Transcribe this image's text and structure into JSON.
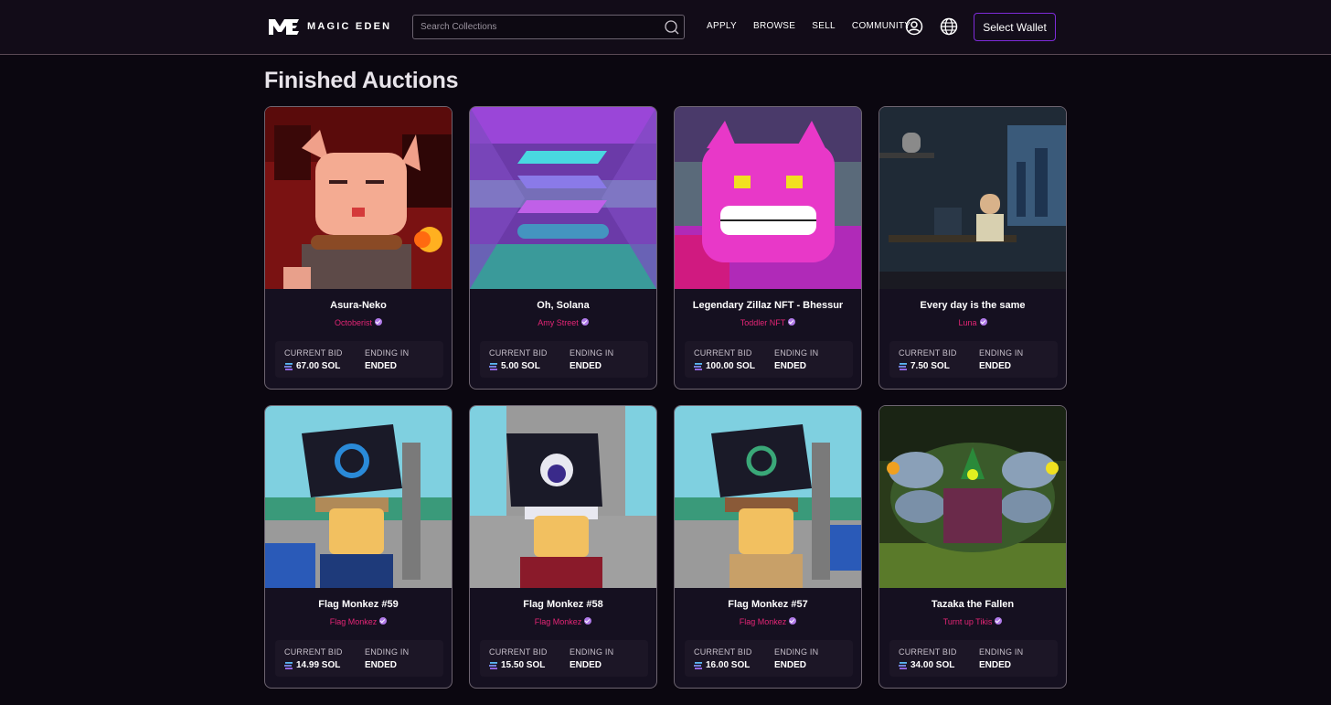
{
  "header": {
    "logo_text": "MAGIC EDEN",
    "search": {
      "placeholder": "Search Collections",
      "value": ""
    },
    "nav": [
      "APPLY",
      "BROWSE",
      "SELL",
      "COMMUNITY"
    ],
    "wallet_button": "Select Wallet"
  },
  "page_title": "Finished Auctions",
  "labels": {
    "current_bid": "CURRENT BID",
    "ending_in": "ENDING IN"
  },
  "colors": {
    "accent": "#7d2bd8",
    "creator": "#e42575",
    "verified": "#b07ae8"
  },
  "cards": [
    {
      "name": "Asura-Neko",
      "creator": "Octoberist",
      "bid": "67.00 SOL",
      "ending": "ENDED",
      "image": "pixel-cat-fire"
    },
    {
      "name": "Oh, Solana",
      "creator": "Amy Street",
      "bid": "5.00 SOL",
      "ending": "ENDED",
      "image": "solana-logo-art"
    },
    {
      "name": "Legendary Zillaz NFT - Bhessur",
      "creator": "Toddler NFT",
      "bid": "100.00 SOL",
      "ending": "ENDED",
      "image": "pink-monster"
    },
    {
      "name": "Every day is the same",
      "creator": "Luna",
      "bid": "7.50 SOL",
      "ending": "ENDED",
      "image": "pixel-room"
    },
    {
      "name": "Flag Monkez #59",
      "creator": "Flag Monkez",
      "bid": "14.99 SOL",
      "ending": "ENDED",
      "image": "monkey-flag-blue"
    },
    {
      "name": "Flag Monkez #58",
      "creator": "Flag Monkez",
      "bid": "15.50 SOL",
      "ending": "ENDED",
      "image": "monkey-flag-white"
    },
    {
      "name": "Flag Monkez #57",
      "creator": "Flag Monkez",
      "bid": "16.00 SOL",
      "ending": "ENDED",
      "image": "monkey-flag-green"
    },
    {
      "name": "Tazaka the Fallen",
      "creator": "Turnt up Tikis",
      "bid": "34.00 SOL",
      "ending": "ENDED",
      "image": "dragon-art"
    }
  ]
}
